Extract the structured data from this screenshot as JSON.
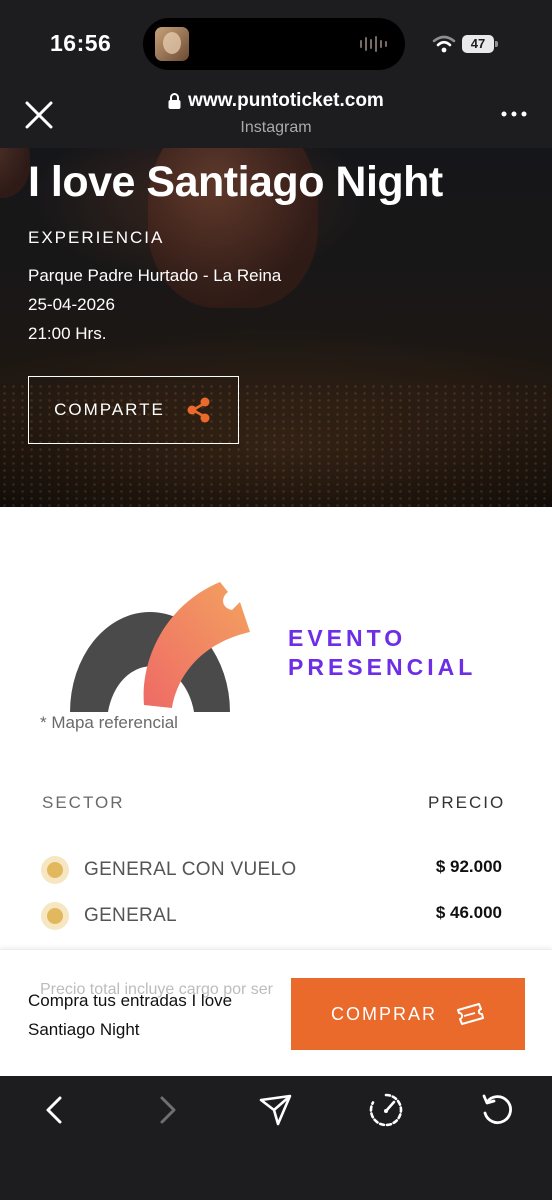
{
  "status_bar": {
    "time": "16:56",
    "battery": "47",
    "icons": [
      "wifi-icon",
      "battery-icon",
      "audio-wave-icon"
    ]
  },
  "browser": {
    "url": "www.puntoticket.com",
    "source": "Instagram",
    "icons": [
      "close-icon",
      "lock-icon",
      "more-icon"
    ]
  },
  "event": {
    "title": "I love Santiago Night",
    "category": "EXPERIENCIA",
    "venue": "Parque Padre Hurtado - La Reina",
    "date": "25-04-2026",
    "time": "21:00 Hrs.",
    "share_label": "COMPARTE"
  },
  "map": {
    "event_type_line1": "EVENTO",
    "event_type_line2": "PRESENCIAL",
    "note": "* Mapa referencial"
  },
  "sectors": {
    "header_sector": "SECTOR",
    "header_price": "PRECIO",
    "rows": [
      {
        "name": "GENERAL CON VUELO",
        "price": "$ 92.000"
      },
      {
        "name": "GENERAL",
        "price": "$ 46.000"
      }
    ]
  },
  "purchase": {
    "note_partial": "Precio total incluye cargo por ser",
    "label": "Compra tus entradas I love Santiago Night",
    "buy_label": "COMPRAR"
  },
  "colors": {
    "accent_orange": "#ea6a2c",
    "event_type_purple": "#6d2ee6",
    "sector_dot": "#e2b85e",
    "chrome_dark": "#1d1d20"
  }
}
